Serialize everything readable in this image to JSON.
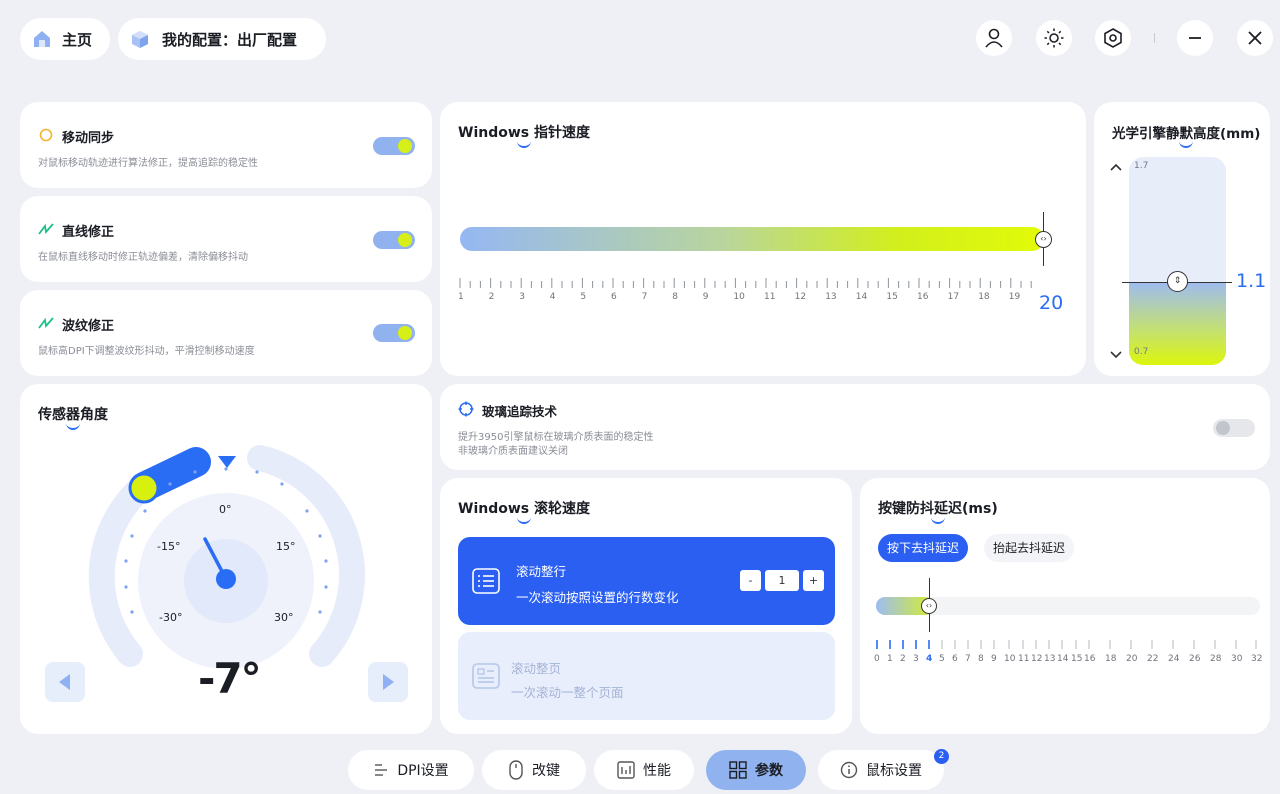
{
  "header": {
    "home_label": "主页",
    "config_label": "我的配置：出厂配置",
    "icons": [
      "user-icon",
      "brightness-icon",
      "settings-hex-icon",
      "minimize-icon",
      "close-icon"
    ]
  },
  "sync": {
    "title": "移动同步",
    "desc": "对鼠标移动轨迹进行算法修正，提高追踪的稳定性",
    "on": true
  },
  "straight": {
    "title": "直线修正",
    "desc": "在鼠标直线移动时修正轨迹偏差，清除偏移抖动",
    "on": true
  },
  "ripple": {
    "title": "波纹修正",
    "desc": "鼠标高DPI下调整波纹形抖动，平滑控制移动速度",
    "on": true
  },
  "pointer": {
    "title": "Windows 指针速度",
    "ticks": [
      "1",
      "2",
      "3",
      "4",
      "5",
      "6",
      "7",
      "8",
      "9",
      "10",
      "11",
      "12",
      "13",
      "14",
      "15",
      "16",
      "17",
      "18",
      "19"
    ],
    "value": "20",
    "level": 1.0
  },
  "lod": {
    "title": "光学引擎静默高度(mm)",
    "max": "1.7",
    "min": "0.7",
    "value": "1.1"
  },
  "sensor": {
    "title": "传感器角度",
    "labels": {
      "zero": "0°",
      "m15": "-15°",
      "p15": "15°",
      "m30": "-30°",
      "p30": "30°"
    },
    "value": "-7°"
  },
  "glass": {
    "title": "玻璃追踪技术",
    "desc1": "提升3950引擎鼠标在玻璃介质表面的稳定性",
    "desc2": "非玻璃介质表面建议关闭",
    "on": false
  },
  "scroll": {
    "title": "Windows 滚轮速度",
    "line": {
      "title": "滚动整行",
      "desc": "一次滚动按照设置的行数变化",
      "minus": "-",
      "value": "1",
      "plus": "+"
    },
    "page": {
      "title": "滚动整页",
      "desc": "一次滚动一整个页面"
    }
  },
  "debounce": {
    "title": "按键防抖延迟(ms)",
    "tab_press": "按下去抖延迟",
    "tab_release": "抬起去抖延迟",
    "ticks": [
      "0",
      "1",
      "2",
      "3",
      "4",
      "5",
      "6",
      "7",
      "8",
      "9",
      "10",
      "11",
      "12",
      "13",
      "14",
      "15",
      "16",
      "18",
      "20",
      "22",
      "24",
      "26",
      "28",
      "30",
      "32"
    ],
    "selected": "4"
  },
  "nav": {
    "dpi": "DPI设置",
    "keys": "改键",
    "perf": "性能",
    "params": "参数",
    "mouse": "鼠标设置",
    "mouse_badge": "2"
  },
  "colors": {
    "accent": "#2a6df5",
    "lime": "#dcf50c",
    "light_blue": "#90b2ee"
  }
}
